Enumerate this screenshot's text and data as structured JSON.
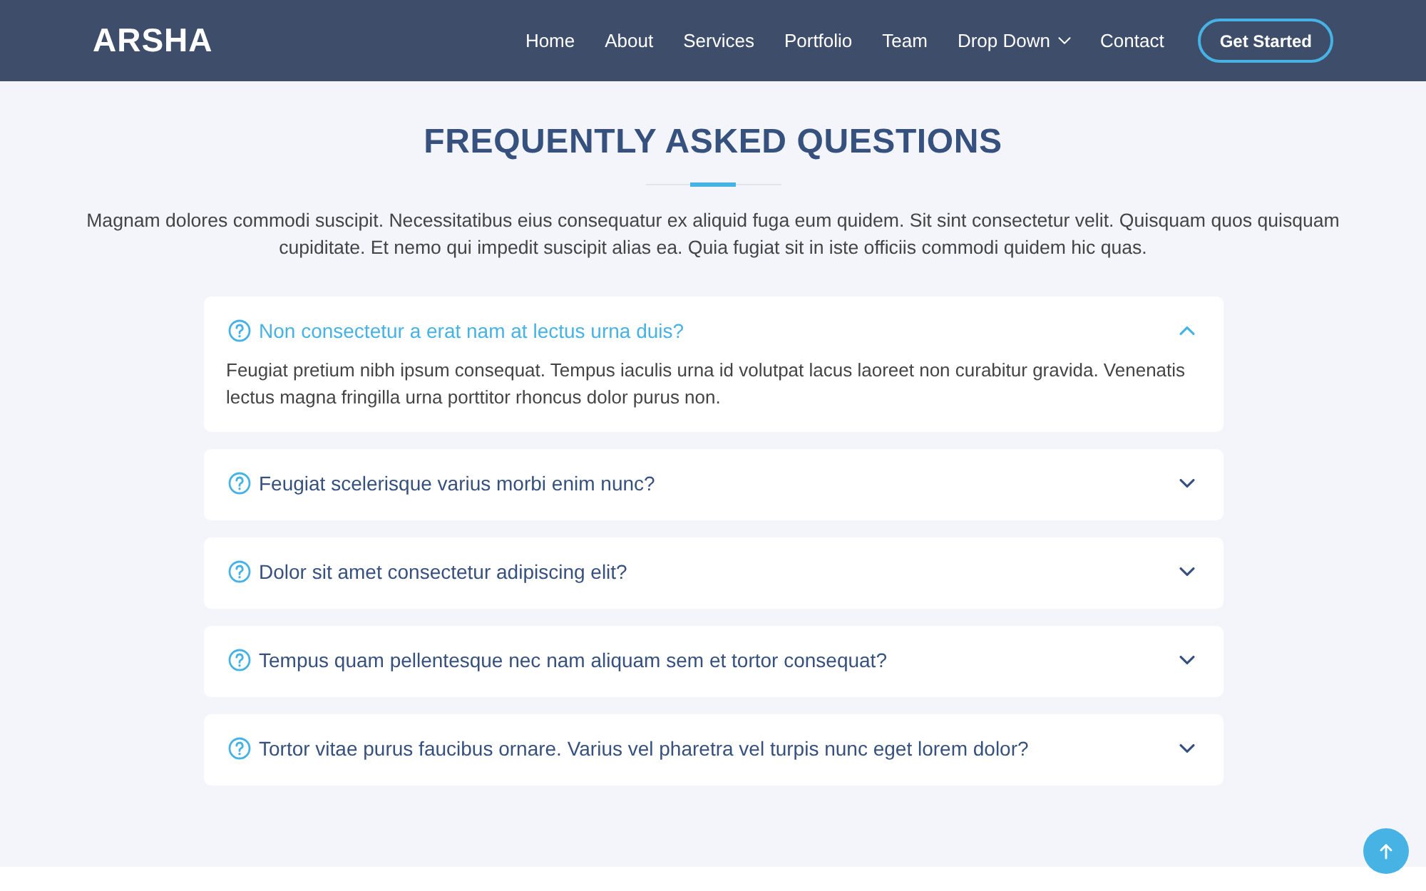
{
  "header": {
    "logo": "ARSHA",
    "nav": [
      {
        "label": "Home",
        "dropdown": false
      },
      {
        "label": "About",
        "dropdown": false
      },
      {
        "label": "Services",
        "dropdown": false
      },
      {
        "label": "Portfolio",
        "dropdown": false
      },
      {
        "label": "Team",
        "dropdown": false
      },
      {
        "label": "Drop Down",
        "dropdown": true
      },
      {
        "label": "Contact",
        "dropdown": false
      }
    ],
    "cta": "Get Started"
  },
  "section": {
    "title": "FREQUENTLY ASKED QUESTIONS",
    "intro": "Magnam dolores commodi suscipit. Necessitatibus eius consequatur ex aliquid fuga eum quidem. Sit sint consectetur velit. Quisquam quos quisquam cupiditate. Et nemo qui impedit suscipit alias ea. Quia fugiat sit in iste officiis commodi quidem hic quas."
  },
  "faq": [
    {
      "question": "Non consectetur a erat nam at lectus urna duis?",
      "answer": "Feugiat pretium nibh ipsum consequat. Tempus iaculis urna id volutpat lacus laoreet non curabitur gravida. Venenatis lectus magna fringilla urna porttitor rhoncus dolor purus non.",
      "expanded": true
    },
    {
      "question": "Feugiat scelerisque varius morbi enim nunc?",
      "expanded": false
    },
    {
      "question": "Dolor sit amet consectetur adipiscing elit?",
      "expanded": false
    },
    {
      "question": "Tempus quam pellentesque nec nam aliquam sem et tortor consequat?",
      "expanded": false
    },
    {
      "question": "Tortor vitae purus faucibus ornare. Varius vel pharetra vel turpis nunc eget lorem dolor?",
      "expanded": false
    }
  ]
}
